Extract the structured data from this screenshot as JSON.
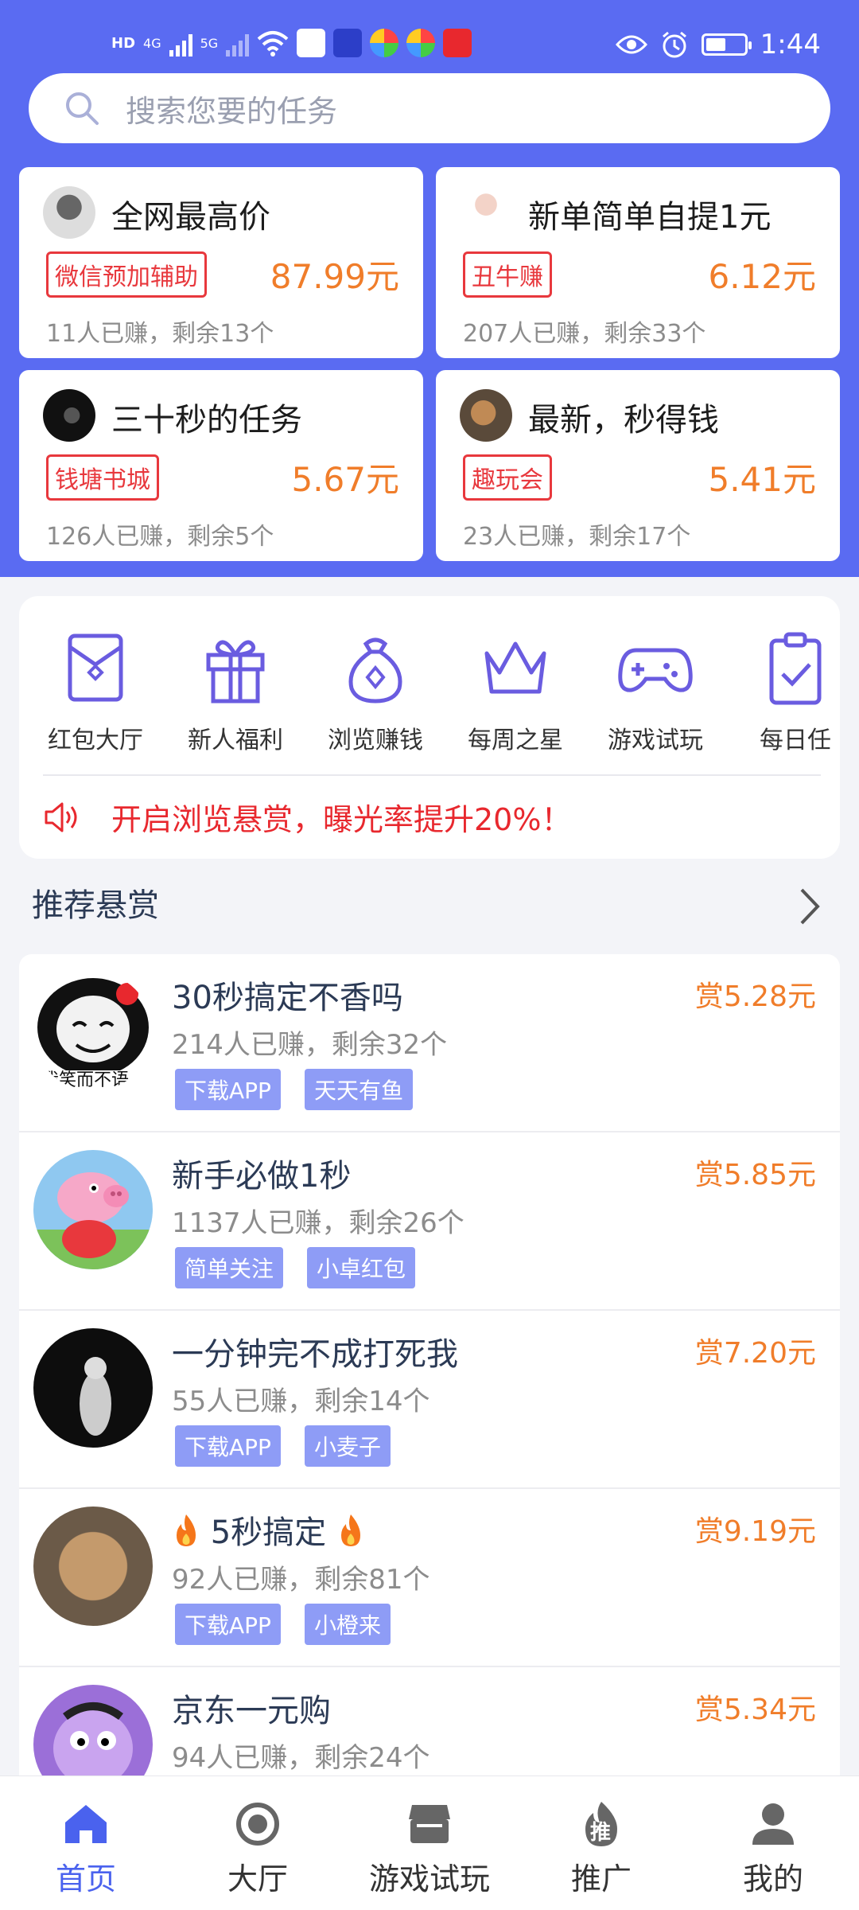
{
  "status_bar": {
    "indicators": [
      "HD",
      "4G",
      "5G"
    ],
    "time": "1:44"
  },
  "search": {
    "placeholder": "搜索您要的任务"
  },
  "top_cards": [
    {
      "title": "全网最高价",
      "tag": "微信预加辅助",
      "price": "87.99元",
      "stats": "11人已赚，剩余13个"
    },
    {
      "title": "新单简单自提1元",
      "tag": "丑牛赚",
      "price": "6.12元",
      "stats": "207人已赚，剩余33个"
    },
    {
      "title": "三十秒的任务",
      "tag": "钱塘书城",
      "price": "5.67元",
      "stats": "126人已赚，剩余5个"
    },
    {
      "title": "最新，秒得钱",
      "tag": "趣玩会",
      "price": "5.41元",
      "stats": "23人已赚，剩余17个"
    }
  ],
  "menu": {
    "items": [
      {
        "label": "红包大厅",
        "icon": "red-envelope-icon"
      },
      {
        "label": "新人福利",
        "icon": "gift-icon"
      },
      {
        "label": "浏览赚钱",
        "icon": "money-bag-icon"
      },
      {
        "label": "每周之星",
        "icon": "crown-icon"
      },
      {
        "label": "游戏试玩",
        "icon": "gamepad-icon"
      },
      {
        "label": "每日任",
        "icon": "clipboard-check-icon"
      }
    ],
    "notice": "开启浏览悬赏，曝光率提升20%！"
  },
  "section": {
    "title": "推荐悬赏"
  },
  "tasks": [
    {
      "title": "30秒搞定不香吗",
      "stats": "214人已赚，剩余32个",
      "tags": [
        "下载APP",
        "天天有鱼"
      ],
      "reward": "赏5.28元",
      "avatar_text": "我笑而不语"
    },
    {
      "title": "新手必做1秒",
      "stats": "1137人已赚，剩余26个",
      "tags": [
        "简单关注",
        "小卓红包"
      ],
      "reward": "赏5.85元"
    },
    {
      "title": "一分钟完不成打死我",
      "stats": "55人已赚，剩余14个",
      "tags": [
        "下载APP",
        "小麦子"
      ],
      "reward": "赏7.20元"
    },
    {
      "title": "5秒搞定",
      "stats": "92人已赚，剩余81个",
      "tags": [
        "下载APP",
        "小橙来"
      ],
      "reward": "赏9.19元"
    },
    {
      "title": "京东一元购",
      "stats": "94人已赚，剩余24个",
      "tags": [],
      "reward": "赏5.34元"
    }
  ],
  "tabbar": [
    {
      "label": "首页",
      "icon": "home-icon"
    },
    {
      "label": "大厅",
      "icon": "circle-target-icon"
    },
    {
      "label": "游戏试玩",
      "icon": "store-icon"
    },
    {
      "label": "推广",
      "icon": "flame-icon",
      "badge": "推"
    },
    {
      "label": "我的",
      "icon": "user-icon"
    }
  ],
  "colors": {
    "header_bg": "#5a6bf2",
    "price": "#f07d2a",
    "tag_red": "#e8383d",
    "tag_blue": "#8e9cf6",
    "icon_purple": "#6a5ce0",
    "active_tab": "#4a62ee"
  }
}
